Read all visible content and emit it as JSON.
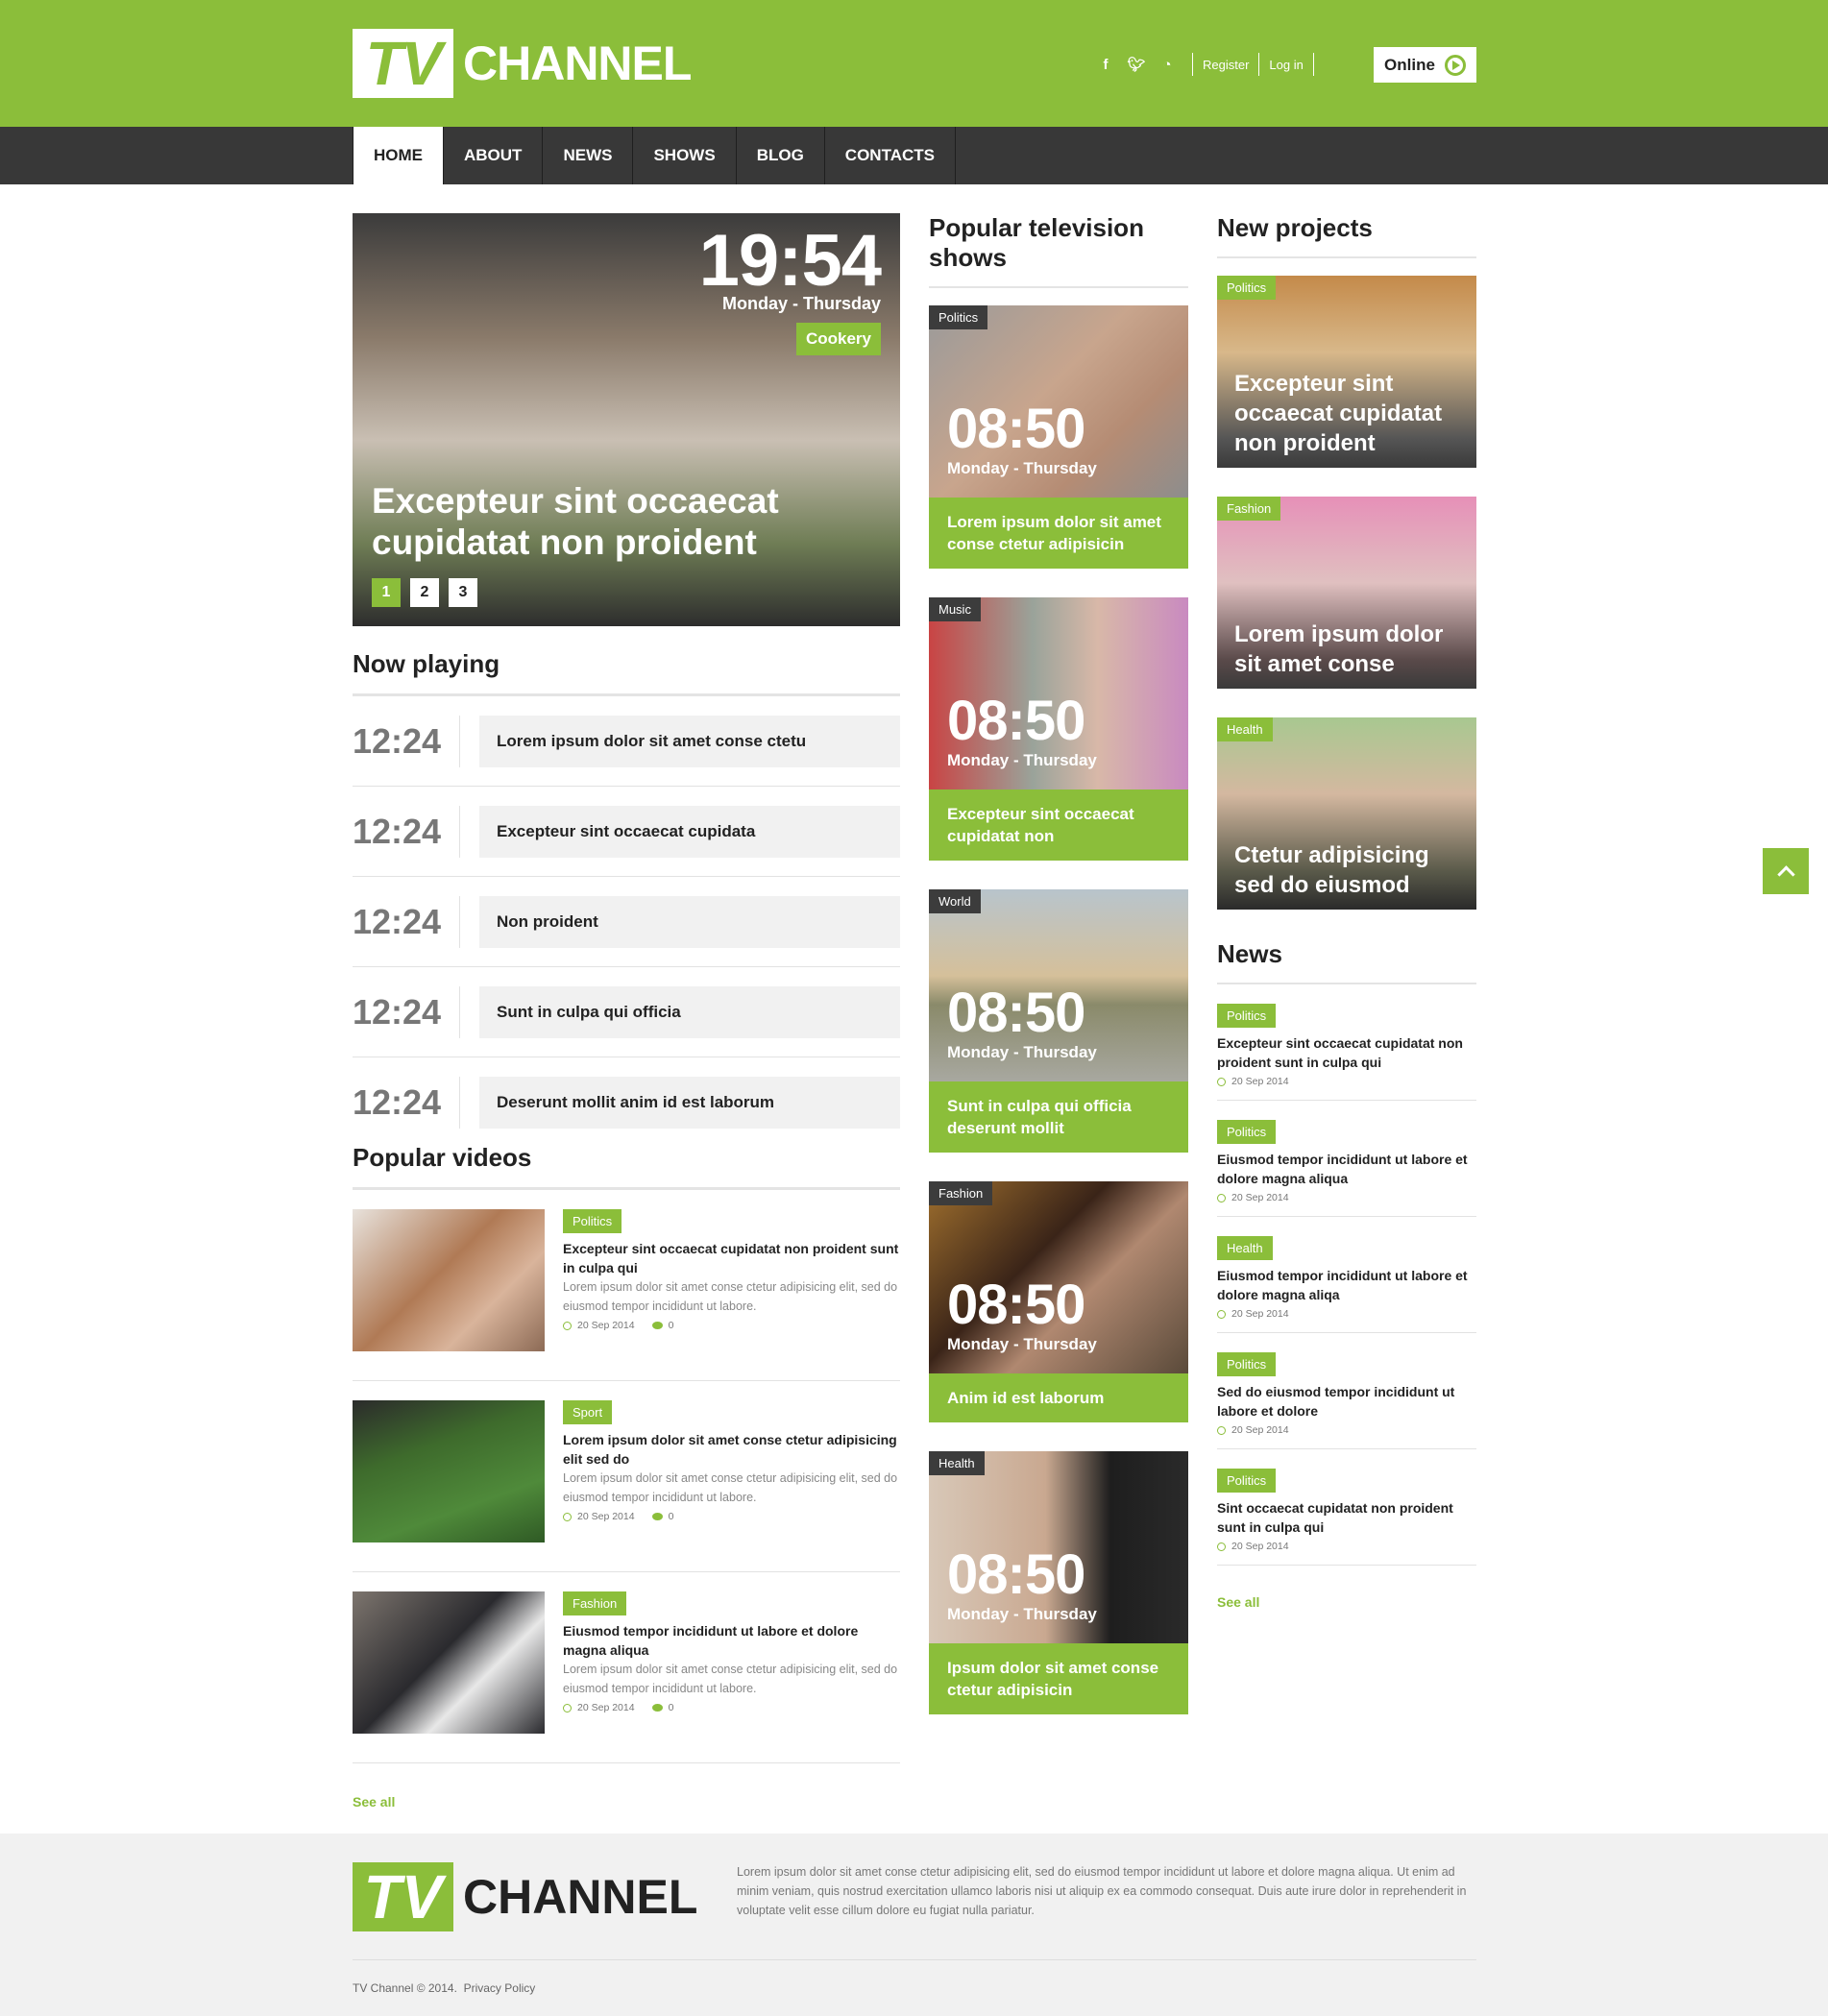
{
  "header": {
    "logo_tv": "TV",
    "logo_channel": "CHANNEL",
    "social": [
      "f",
      "t",
      "rss"
    ],
    "register": "Register",
    "login": "Log in",
    "online": "Online"
  },
  "nav": [
    "HOME",
    "ABOUT",
    "NEWS",
    "SHOWS",
    "BLOG",
    "CONTACTS"
  ],
  "hero": {
    "time": "19:54",
    "days": "Monday - Thursday",
    "tag": "Cookery",
    "title": "Excepteur sint occaecat cupidatat non proident",
    "pages": [
      "1",
      "2",
      "3"
    ]
  },
  "now_playing": {
    "heading": "Now playing",
    "items": [
      {
        "time": "12:24",
        "title": "Lorem ipsum dolor sit amet conse ctetu"
      },
      {
        "time": "12:24",
        "title": "Excepteur sint occaecat cupidata"
      },
      {
        "time": "12:24",
        "title": "Non proident"
      },
      {
        "time": "12:24",
        "title": "Sunt in culpa qui officia"
      },
      {
        "time": "12:24",
        "title": "Deserunt mollit anim id est laborum"
      }
    ]
  },
  "popular_videos": {
    "heading": "Popular videos",
    "items": [
      {
        "tag": "Politics",
        "title": "Excepteur sint occaecat cupidatat non proident sunt in culpa qui",
        "desc": "Lorem ipsum dolor sit amet conse ctetur adipisicing elit, sed do eiusmod tempor incididunt ut labore.",
        "date": "20 Sep 2014",
        "comments": "0"
      },
      {
        "tag": "Sport",
        "title": "Lorem ipsum dolor sit amet conse ctetur adipisicing elit sed do",
        "desc": "Lorem ipsum dolor sit amet conse ctetur adipisicing elit, sed do eiusmod tempor incididunt ut labore.",
        "date": "20 Sep 2014",
        "comments": "0"
      },
      {
        "tag": "Fashion",
        "title": "Eiusmod tempor incididunt ut labore et dolore magna aliqua",
        "desc": "Lorem ipsum dolor sit amet conse ctetur adipisicing elit, sed do eiusmod tempor incididunt ut labore.",
        "date": "20 Sep 2014",
        "comments": "0"
      }
    ],
    "see_all": "See all"
  },
  "tv_shows": {
    "heading": "Popular television shows",
    "items": [
      {
        "cat": "Politics",
        "time": "08:50",
        "days": "Monday - Thursday",
        "title": "Lorem ipsum dolor sit amet conse ctetur adipisicin"
      },
      {
        "cat": "Music",
        "time": "08:50",
        "days": "Monday - Thursday",
        "title": "Excepteur sint occaecat cupidatat non"
      },
      {
        "cat": "World",
        "time": "08:50",
        "days": "Monday - Thursday",
        "title": "Sunt in culpa qui officia deserunt mollit"
      },
      {
        "cat": "Fashion",
        "time": "08:50",
        "days": "Monday - Thursday",
        "title": "Anim id est laborum"
      },
      {
        "cat": "Health",
        "time": "08:50",
        "days": "Monday - Thursday",
        "title": "Ipsum dolor sit amet conse ctetur adipisicin"
      }
    ]
  },
  "new_projects": {
    "heading": "New projects",
    "items": [
      {
        "cat": "Politics",
        "title": "Excepteur sint occaecat cupidatat non proident"
      },
      {
        "cat": "Fashion",
        "title": "Lorem ipsum dolor sit amet conse"
      },
      {
        "cat": "Health",
        "title": "Ctetur adipisicing sed do eiusmod"
      }
    ]
  },
  "news": {
    "heading": "News",
    "items": [
      {
        "tag": "Politics",
        "title": "Excepteur sint occaecat cupidatat non proident sunt in culpa qui",
        "date": "20 Sep 2014"
      },
      {
        "tag": "Politics",
        "title": "Eiusmod tempor incididunt ut labore et dolore magna aliqua",
        "date": "20 Sep 2014"
      },
      {
        "tag": "Health",
        "title": "Eiusmod tempor incididunt ut labore et dolore magna aliqa",
        "date": "20 Sep 2014"
      },
      {
        "tag": "Politics",
        "title": "Sed do eiusmod tempor incididunt ut labore et dolore",
        "date": "20 Sep 2014"
      },
      {
        "tag": "Politics",
        "title": "Sint occaecat cupidatat non proident sunt in culpa qui",
        "date": "20 Sep 2014"
      }
    ],
    "see_all": "See all"
  },
  "footer": {
    "logo_tv": "TV",
    "logo_channel": "CHANNEL",
    "text": "Lorem ipsum dolor sit amet conse ctetur adipisicing elit, sed do eiusmod tempor incididunt ut labore et dolore magna aliqua. Ut enim ad minim veniam, quis nostrud exercitation ullamco laboris nisi ut aliquip ex ea commodo consequat. Duis aute irure dolor in reprehenderit in voluptate velit esse cillum dolore eu fugiat nulla pariatur.",
    "copyright": "TV Channel © 2014.",
    "privacy": "Privacy Policy"
  },
  "colors": {
    "accent": "#8bbe3a",
    "nav_bg": "#383838",
    "footer_bg": "#f1f1f1"
  }
}
